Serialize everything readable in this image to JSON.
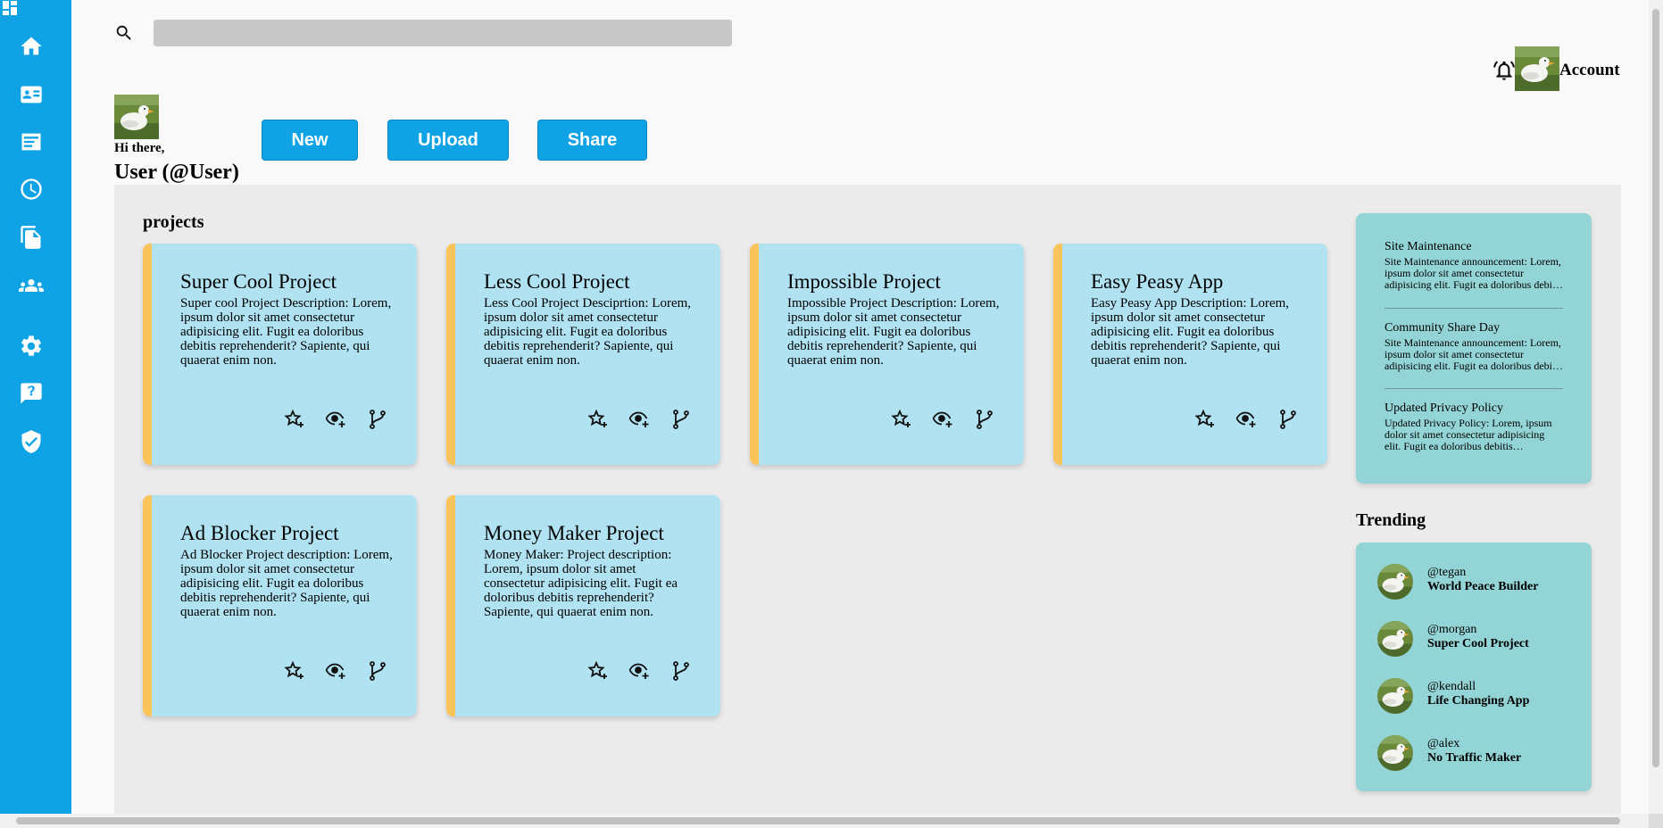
{
  "search": {
    "placeholder": ""
  },
  "header": {
    "account_label": "Account",
    "greeting": "Hi there,",
    "user_name": "User (@User)"
  },
  "actions": {
    "new": "New",
    "upload": "Upload",
    "share": "Share"
  },
  "sidebar": {
    "items": [
      {
        "icon": "home-icon"
      },
      {
        "icon": "contact-card-icon"
      },
      {
        "icon": "feed-icon"
      },
      {
        "icon": "history-clock-icon"
      },
      {
        "icon": "documents-icon"
      },
      {
        "icon": "people-icon"
      },
      {
        "icon": "gear-icon"
      },
      {
        "icon": "help-chat-icon"
      },
      {
        "icon": "shield-check-icon"
      }
    ]
  },
  "projects": {
    "title": "projects",
    "cards": [
      {
        "title": "Super Cool Project",
        "description": "Super cool Project Description: Lorem, ipsum dolor sit amet consectetur adipisicing elit. Fugit ea doloribus debitis reprehenderit? Sapiente, qui quaerat enim non."
      },
      {
        "title": "Less Cool Project",
        "description": "Less Cool Project Desciprtion: Lorem, ipsum dolor sit amet consectetur adipisicing elit. Fugit ea doloribus debitis reprehenderit? Sapiente, qui quaerat enim non."
      },
      {
        "title": "Impossible Project",
        "description": "Impossible Project Description: Lorem, ipsum dolor sit amet consectetur adipisicing elit. Fugit ea doloribus debitis reprehenderit? Sapiente, qui quaerat enim non."
      },
      {
        "title": "Easy Peasy App",
        "description": "Easy Peasy App Description: Lorem, ipsum dolor sit amet consectetur adipisicing elit. Fugit ea doloribus debitis reprehenderit? Sapiente, qui quaerat enim non."
      },
      {
        "title": "Ad Blocker Project",
        "description": "Ad Blocker Project description: Lorem, ipsum dolor sit amet consectetur adipisicing elit. Fugit ea doloribus debitis reprehenderit? Sapiente, qui quaerat enim non."
      },
      {
        "title": "Money Maker Project",
        "description": "Money Maker: Project description: Lorem, ipsum dolor sit amet consectetur adipisicing elit. Fugit ea doloribus debitis reprehenderit? Sapiente, qui quaerat enim non."
      }
    ]
  },
  "announcements": [
    {
      "title": "Site Maintenance",
      "text": "Site Maintenance announcement: Lorem, ipsum dolor sit amet consectetur adipisicing elit. Fugit ea doloribus debitis reprehenderit?"
    },
    {
      "title": "Community Share Day",
      "text": "Site Maintenance announcement: Lorem, ipsum dolor sit amet consectetur adipisicing elit. Fugit ea doloribus debitis reprehenderit?"
    },
    {
      "title": "Updated Privacy Policy",
      "text": "Updated Privacy Policy: Lorem, ipsum dolor sit amet consectetur adipisicing elit. Fugit ea doloribus debitis reprehenderit?"
    }
  ],
  "trending": {
    "title": "Trending",
    "items": [
      {
        "handle": "@tegan",
        "project": "World Peace Builder"
      },
      {
        "handle": "@morgan",
        "project": "Super Cool Project"
      },
      {
        "handle": "@kendall",
        "project": "Life Changing App"
      },
      {
        "handle": "@alex",
        "project": "No Traffic Maker"
      }
    ]
  },
  "colors": {
    "sidebar": "#0fa3e6",
    "card": "#b0e2f2",
    "card_accent": "#fbc45a",
    "panel": "#93d4d7"
  }
}
